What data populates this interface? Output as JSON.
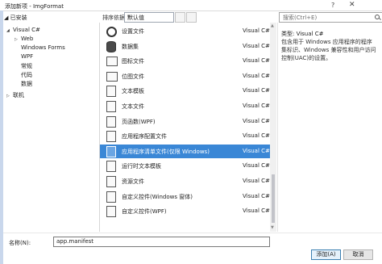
{
  "window": {
    "title": "添加新项 - ImgFormat",
    "help": "?",
    "close": "✕"
  },
  "toolbar": {
    "installed_label": "◢ 已安装",
    "sort_label": "排序依据:",
    "sort_value": "默认值",
    "search_placeholder": "搜索(Ctrl+E)"
  },
  "tree": [
    {
      "label": "Visual C#",
      "caret": "◢"
    },
    {
      "label": "Web",
      "caret": "▷"
    },
    {
      "label": "Windows Forms",
      "caret": ""
    },
    {
      "label": "WPF",
      "caret": ""
    },
    {
      "label": "常规",
      "caret": ""
    },
    {
      "label": "代码",
      "caret": ""
    },
    {
      "label": "数据",
      "caret": ""
    },
    {
      "label": "联机",
      "caret": "▷"
    }
  ],
  "items": [
    {
      "name": "设置文件",
      "lang": "Visual C#",
      "icon": "gear-icon"
    },
    {
      "name": "数据集",
      "lang": "Visual C#",
      "icon": "database-icon"
    },
    {
      "name": "图标文件",
      "lang": "Visual C#",
      "icon": "image-icon"
    },
    {
      "name": "位图文件",
      "lang": "Visual C#",
      "icon": "image-icon"
    },
    {
      "name": "文本模板",
      "lang": "Visual C#",
      "icon": "document-icon"
    },
    {
      "name": "文本文件",
      "lang": "Visual C#",
      "icon": "document-icon"
    },
    {
      "name": "页函数(WPF)",
      "lang": "Visual C#",
      "icon": "page-function-icon"
    },
    {
      "name": "应用程序配置文件",
      "lang": "Visual C#",
      "icon": "config-icon"
    },
    {
      "name": "应用程序清单文件(仅限 Windows)",
      "lang": "Visual C#",
      "icon": "manifest-icon"
    },
    {
      "name": "运行时文本模板",
      "lang": "Visual C#",
      "icon": "template-icon"
    },
    {
      "name": "资源文件",
      "lang": "Visual C#",
      "icon": "resource-icon"
    },
    {
      "name": "自定义控件(Windows 窗体)",
      "lang": "Visual C#",
      "icon": "control-icon"
    },
    {
      "name": "自定义控件(WPF)",
      "lang": "Visual C#",
      "icon": "control-icon"
    }
  ],
  "selected_index": 8,
  "detail": {
    "type": "类型: Visual C#",
    "description": "包含用于 Windows 应用程序的程序集标识、Windows 兼容性和用户访问控制(UAC)的设置。"
  },
  "footer": {
    "name_label": "名称(N):",
    "name_value": "app.manifest",
    "add_label": "添加(A)",
    "cancel_label": "取消"
  },
  "colors": {
    "selection": "#3a87d6",
    "accent_strip": "#c9d7ec"
  }
}
